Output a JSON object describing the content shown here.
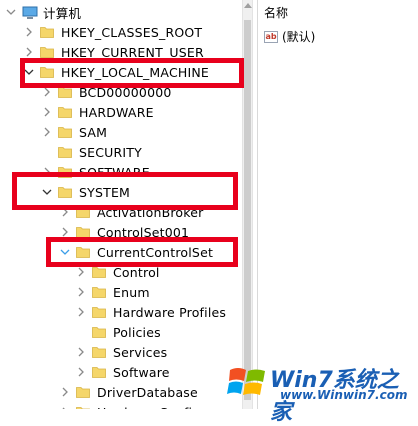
{
  "tree": {
    "root_label": "计算机",
    "nodes": [
      {
        "label": "HKEY_CLASSES_ROOT",
        "state": "collapsed"
      },
      {
        "label": "HKEY_CURRENT_USER",
        "state": "collapsed"
      },
      {
        "label": "HKEY_LOCAL_MACHINE",
        "state": "expanded"
      },
      {
        "label": "BCD00000000",
        "state": "collapsed"
      },
      {
        "label": "HARDWARE",
        "state": "collapsed"
      },
      {
        "label": "SAM",
        "state": "collapsed"
      },
      {
        "label": "SECURITY",
        "state": "leaf"
      },
      {
        "label": "SOFTWARE",
        "state": "collapsed"
      },
      {
        "label": "SYSTEM",
        "state": "expanded"
      },
      {
        "label": "ActivationBroker",
        "state": "collapsed"
      },
      {
        "label": "ControlSet001",
        "state": "collapsed"
      },
      {
        "label": "CurrentControlSet",
        "state": "expanded"
      },
      {
        "label": "Control",
        "state": "collapsed"
      },
      {
        "label": "Enum",
        "state": "collapsed"
      },
      {
        "label": "Hardware Profiles",
        "state": "collapsed"
      },
      {
        "label": "Policies",
        "state": "leaf"
      },
      {
        "label": "Services",
        "state": "collapsed"
      },
      {
        "label": "Software",
        "state": "collapsed"
      },
      {
        "label": "DriverDatabase",
        "state": "collapsed"
      },
      {
        "label": "HardwareConfig",
        "state": "collapsed"
      }
    ]
  },
  "list": {
    "column_name": "名称",
    "values": [
      {
        "icon": "string-value-icon",
        "icon_text": "ab",
        "name": "(默认)"
      }
    ]
  },
  "watermark": {
    "title": "Win7系统之家",
    "url": "www.Winwin7.com"
  },
  "colors": {
    "highlight_box": "#e8001c",
    "folder": "#f5d66a",
    "chevron": "#8a8a8a",
    "chevron_expanded_selected": "#3c9ee8"
  }
}
